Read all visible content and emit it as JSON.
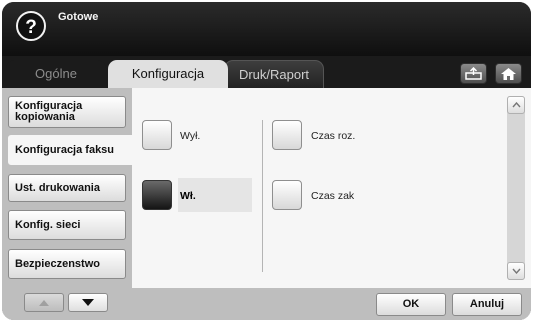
{
  "header": {
    "help_symbol": "?",
    "status": "Gotowe"
  },
  "tabs": [
    {
      "label": "Ogólne",
      "active": false
    },
    {
      "label": "Konfiguracja",
      "active": true
    },
    {
      "label": "Druk/Raport",
      "active": false
    }
  ],
  "top_icons": [
    "tray-icon",
    "home-icon"
  ],
  "sidebar": {
    "items": [
      {
        "label": "Konfiguracja kopiowania",
        "selected": false
      },
      {
        "label": "Konfiguracja faksu",
        "selected": true
      },
      {
        "label": "Ust. drukowania",
        "selected": false
      },
      {
        "label": "Konfig. sieci",
        "selected": false
      },
      {
        "label": "Bezpieczenstwo",
        "selected": false
      }
    ]
  },
  "options": {
    "left": [
      {
        "label": "Wył.",
        "checked": false
      },
      {
        "label": "Wł.",
        "checked": true
      }
    ],
    "right": [
      {
        "label": "Czas roz.",
        "checked": false
      },
      {
        "label": "Czas zak",
        "checked": false
      }
    ]
  },
  "actions": {
    "ok_label": "OK",
    "cancel_label": "Anuluj"
  },
  "colors": {
    "header_bg": "#111111",
    "panel_bg": "#f6f6f6",
    "selected_option": "#1a1a1a"
  }
}
